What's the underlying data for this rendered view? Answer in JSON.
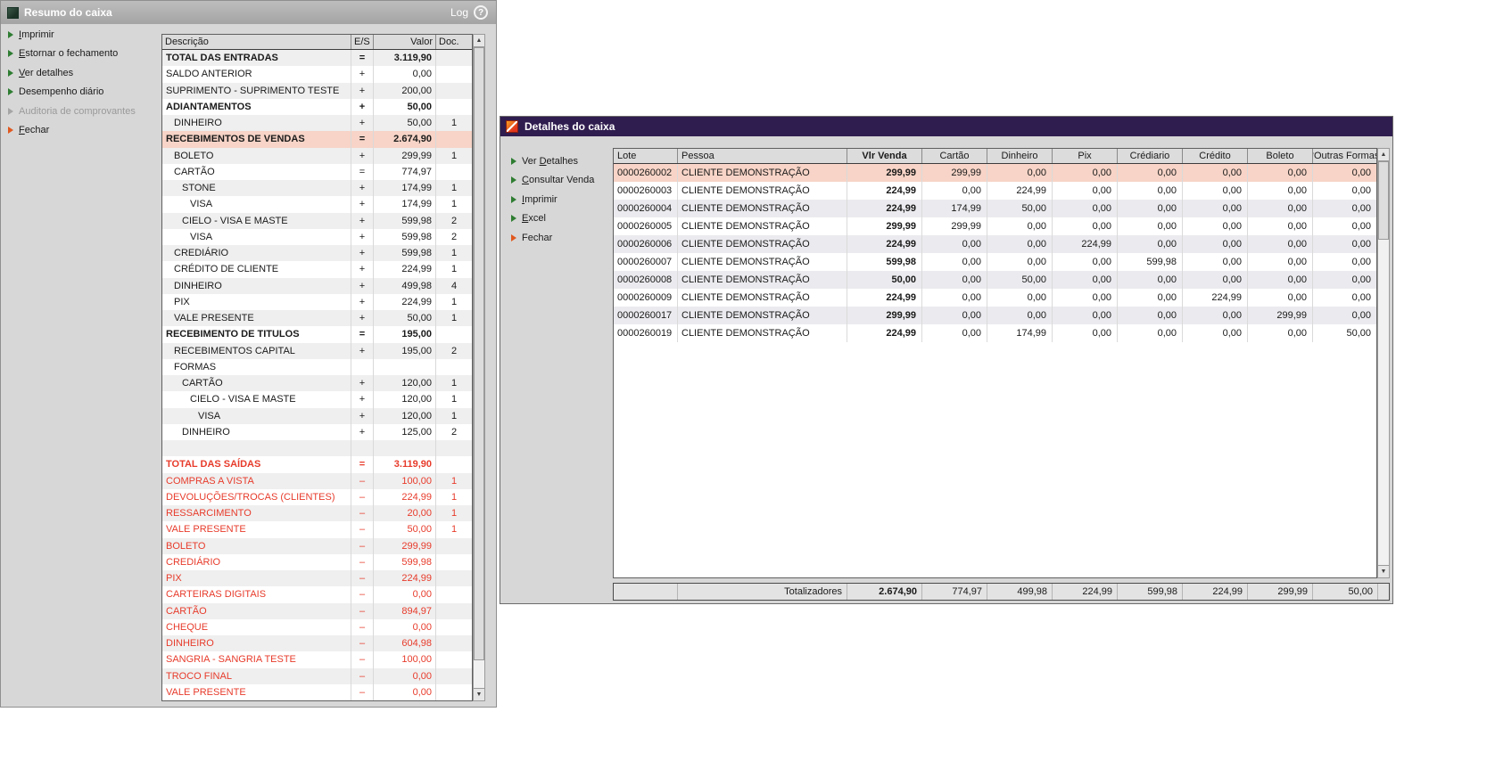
{
  "colors": {
    "titlebar-gray": "#a4a4a4",
    "titlebar-purple": "#301d4f",
    "window-bg": "#d7d7d7",
    "pink-highlight": "#f7d4c7",
    "red-text": "#e73b2b",
    "green-arrow": "#2e7d32",
    "orange-arrow": "#e0581f",
    "alt-row": "#efefef",
    "alt-row-right": "#ebebef",
    "header-bg": "#dcdcdc"
  },
  "icons": {
    "scroll_up": "▲",
    "scroll_down": "▼",
    "help": "?"
  },
  "left_window": {
    "title": "Resumo do caixa",
    "titlebar": {
      "log_label": "Log"
    },
    "menu": [
      {
        "label": "Imprimir",
        "accel": 0,
        "enabled": true,
        "arrow": "green"
      },
      {
        "label": "Estornar o fechamento",
        "accel": 0,
        "enabled": true,
        "arrow": "green"
      },
      {
        "label": "Ver detalhes",
        "accel": 0,
        "enabled": true,
        "arrow": "green"
      },
      {
        "label": "Desempenho diário",
        "accel": null,
        "enabled": true,
        "arrow": "green"
      },
      {
        "label": "Auditoria de comprovantes",
        "accel": null,
        "enabled": false,
        "arrow": "green"
      },
      {
        "label": "Fechar",
        "accel": 0,
        "enabled": true,
        "arrow": "orange"
      }
    ],
    "table": {
      "headers": [
        "Descrição",
        "E/S",
        "Valor",
        "Doc."
      ],
      "rows": [
        {
          "desc": "TOTAL DAS ENTRADAS",
          "indent": 0,
          "es": "=",
          "valor": "3.119,90",
          "doc": "",
          "bold": true,
          "style": "normal"
        },
        {
          "desc": "SALDO ANTERIOR",
          "indent": 0,
          "es": "+",
          "valor": "0,00",
          "doc": "",
          "bold": false,
          "style": "normal"
        },
        {
          "desc": "SUPRIMENTO - SUPRIMENTO TESTE",
          "indent": 0,
          "es": "+",
          "valor": "200,00",
          "doc": "",
          "bold": false,
          "style": "normal"
        },
        {
          "desc": "ADIANTAMENTOS",
          "indent": 0,
          "es": "+",
          "valor": "50,00",
          "doc": "",
          "bold": true,
          "style": "normal"
        },
        {
          "desc": "DINHEIRO",
          "indent": 1,
          "es": "+",
          "valor": "50,00",
          "doc": "1",
          "bold": false,
          "style": "normal"
        },
        {
          "desc": "RECEBIMENTOS DE VENDAS",
          "indent": 0,
          "es": "=",
          "valor": "2.674,90",
          "doc": "",
          "bold": true,
          "style": "pink"
        },
        {
          "desc": "BOLETO",
          "indent": 1,
          "es": "+",
          "valor": "299,99",
          "doc": "1",
          "bold": false,
          "style": "normal"
        },
        {
          "desc": "CARTÃO",
          "indent": 1,
          "es": "=",
          "valor": "774,97",
          "doc": "",
          "bold": false,
          "style": "normal"
        },
        {
          "desc": "STONE",
          "indent": 2,
          "es": "+",
          "valor": "174,99",
          "doc": "1",
          "bold": false,
          "style": "normal"
        },
        {
          "desc": "VISA",
          "indent": 3,
          "es": "+",
          "valor": "174,99",
          "doc": "1",
          "bold": false,
          "style": "normal"
        },
        {
          "desc": "CIELO - VISA E MASTE",
          "indent": 2,
          "es": "+",
          "valor": "599,98",
          "doc": "2",
          "bold": false,
          "style": "normal"
        },
        {
          "desc": "VISA",
          "indent": 3,
          "es": "+",
          "valor": "599,98",
          "doc": "2",
          "bold": false,
          "style": "normal"
        },
        {
          "desc": "CREDIÁRIO",
          "indent": 1,
          "es": "+",
          "valor": "599,98",
          "doc": "1",
          "bold": false,
          "style": "normal"
        },
        {
          "desc": "CRÉDITO DE CLIENTE",
          "indent": 1,
          "es": "+",
          "valor": "224,99",
          "doc": "1",
          "bold": false,
          "style": "normal"
        },
        {
          "desc": "DINHEIRO",
          "indent": 1,
          "es": "+",
          "valor": "499,98",
          "doc": "4",
          "bold": false,
          "style": "normal"
        },
        {
          "desc": "PIX",
          "indent": 1,
          "es": "+",
          "valor": "224,99",
          "doc": "1",
          "bold": false,
          "style": "normal"
        },
        {
          "desc": "VALE PRESENTE",
          "indent": 1,
          "es": "+",
          "valor": "50,00",
          "doc": "1",
          "bold": false,
          "style": "normal"
        },
        {
          "desc": "RECEBIMENTO DE TITULOS",
          "indent": 0,
          "es": "=",
          "valor": "195,00",
          "doc": "",
          "bold": true,
          "style": "normal"
        },
        {
          "desc": "RECEBIMENTOS CAPITAL",
          "indent": 1,
          "es": "+",
          "valor": "195,00",
          "doc": "2",
          "bold": false,
          "style": "normal"
        },
        {
          "desc": "FORMAS",
          "indent": 1,
          "es": "",
          "valor": "",
          "doc": "",
          "bold": false,
          "style": "normal"
        },
        {
          "desc": "CARTÃO",
          "indent": 2,
          "es": "+",
          "valor": "120,00",
          "doc": "1",
          "bold": false,
          "style": "normal"
        },
        {
          "desc": "CIELO - VISA E MASTE",
          "indent": 3,
          "es": "+",
          "valor": "120,00",
          "doc": "1",
          "bold": false,
          "style": "normal"
        },
        {
          "desc": "VISA",
          "indent": 4,
          "es": "+",
          "valor": "120,00",
          "doc": "1",
          "bold": false,
          "style": "normal"
        },
        {
          "desc": "DINHEIRO",
          "indent": 2,
          "es": "+",
          "valor": "125,00",
          "doc": "2",
          "bold": false,
          "style": "normal"
        },
        {
          "desc": "",
          "indent": 0,
          "es": "",
          "valor": "",
          "doc": "",
          "bold": false,
          "style": "normal"
        },
        {
          "desc": "TOTAL DAS SAÍDAS",
          "indent": 0,
          "es": "=",
          "valor": "3.119,90",
          "doc": "",
          "bold": true,
          "style": "red"
        },
        {
          "desc": "COMPRAS A VISTA",
          "indent": 0,
          "es": "–",
          "valor": "100,00",
          "doc": "1",
          "bold": false,
          "style": "red"
        },
        {
          "desc": "DEVOLUÇÕES/TROCAS (CLIENTES)",
          "indent": 0,
          "es": "–",
          "valor": "224,99",
          "doc": "1",
          "bold": false,
          "style": "red"
        },
        {
          "desc": "RESSARCIMENTO",
          "indent": 0,
          "es": "–",
          "valor": "20,00",
          "doc": "1",
          "bold": false,
          "style": "red"
        },
        {
          "desc": "VALE PRESENTE",
          "indent": 0,
          "es": "–",
          "valor": "50,00",
          "doc": "1",
          "bold": false,
          "style": "red"
        },
        {
          "desc": "BOLETO",
          "indent": 0,
          "es": "–",
          "valor": "299,99",
          "doc": "",
          "bold": false,
          "style": "red"
        },
        {
          "desc": "CREDIÁRIO",
          "indent": 0,
          "es": "–",
          "valor": "599,98",
          "doc": "",
          "bold": false,
          "style": "red"
        },
        {
          "desc": "PIX",
          "indent": 0,
          "es": "–",
          "valor": "224,99",
          "doc": "",
          "bold": false,
          "style": "red"
        },
        {
          "desc": "CARTEIRAS DIGITAIS",
          "indent": 0,
          "es": "–",
          "valor": "0,00",
          "doc": "",
          "bold": false,
          "style": "red"
        },
        {
          "desc": "CARTÃO",
          "indent": 0,
          "es": "–",
          "valor": "894,97",
          "doc": "",
          "bold": false,
          "style": "red"
        },
        {
          "desc": "CHEQUE",
          "indent": 0,
          "es": "–",
          "valor": "0,00",
          "doc": "",
          "bold": false,
          "style": "red"
        },
        {
          "desc": "DINHEIRO",
          "indent": 0,
          "es": "–",
          "valor": "604,98",
          "doc": "",
          "bold": false,
          "style": "red"
        },
        {
          "desc": "SANGRIA - SANGRIA TESTE",
          "indent": 0,
          "es": "–",
          "valor": "100,00",
          "doc": "",
          "bold": false,
          "style": "red"
        },
        {
          "desc": "TROCO FINAL",
          "indent": 0,
          "es": "–",
          "valor": "0,00",
          "doc": "",
          "bold": false,
          "style": "red"
        },
        {
          "desc": "VALE PRESENTE",
          "indent": 0,
          "es": "–",
          "valor": "0,00",
          "doc": "",
          "bold": false,
          "style": "red"
        }
      ]
    }
  },
  "right_window": {
    "title": "Detalhes do caixa",
    "menu": [
      {
        "label": "Ver Detalhes",
        "accel": 4,
        "enabled": true,
        "arrow": "green"
      },
      {
        "label": "Consultar Venda",
        "accel": 0,
        "enabled": true,
        "arrow": "green"
      },
      {
        "label": "Imprimir",
        "accel": 0,
        "enabled": true,
        "arrow": "green"
      },
      {
        "label": "Excel",
        "accel": 0,
        "enabled": true,
        "arrow": "green"
      },
      {
        "label": "Fechar",
        "accel": null,
        "enabled": true,
        "arrow": "orange"
      }
    ],
    "table": {
      "headers": [
        "Lote",
        "Pessoa",
        "Vlr Venda",
        "Cartão",
        "Dinheiro",
        "Pix",
        "Crédiario",
        "Crédito",
        "Boleto",
        "*Outras Formas"
      ],
      "rows": [
        {
          "lote": "0000260002",
          "pessoa": "CLIENTE DEMONSTRAÇÃO",
          "values": [
            "299,99",
            "299,99",
            "0,00",
            "0,00",
            "0,00",
            "0,00",
            "0,00",
            "0,00"
          ],
          "selected": true
        },
        {
          "lote": "0000260003",
          "pessoa": "CLIENTE DEMONSTRAÇÃO",
          "values": [
            "224,99",
            "0,00",
            "224,99",
            "0,00",
            "0,00",
            "0,00",
            "0,00",
            "0,00"
          ],
          "selected": false
        },
        {
          "lote": "0000260004",
          "pessoa": "CLIENTE DEMONSTRAÇÃO",
          "values": [
            "224,99",
            "174,99",
            "50,00",
            "0,00",
            "0,00",
            "0,00",
            "0,00",
            "0,00"
          ],
          "selected": false
        },
        {
          "lote": "0000260005",
          "pessoa": "CLIENTE DEMONSTRAÇÃO",
          "values": [
            "299,99",
            "299,99",
            "0,00",
            "0,00",
            "0,00",
            "0,00",
            "0,00",
            "0,00"
          ],
          "selected": false
        },
        {
          "lote": "0000260006",
          "pessoa": "CLIENTE DEMONSTRAÇÃO",
          "values": [
            "224,99",
            "0,00",
            "0,00",
            "224,99",
            "0,00",
            "0,00",
            "0,00",
            "0,00"
          ],
          "selected": false
        },
        {
          "lote": "0000260007",
          "pessoa": "CLIENTE DEMONSTRAÇÃO",
          "values": [
            "599,98",
            "0,00",
            "0,00",
            "0,00",
            "599,98",
            "0,00",
            "0,00",
            "0,00"
          ],
          "selected": false
        },
        {
          "lote": "0000260008",
          "pessoa": "CLIENTE DEMONSTRAÇÃO",
          "values": [
            "50,00",
            "0,00",
            "50,00",
            "0,00",
            "0,00",
            "0,00",
            "0,00",
            "0,00"
          ],
          "selected": false
        },
        {
          "lote": "0000260009",
          "pessoa": "CLIENTE DEMONSTRAÇÃO",
          "values": [
            "224,99",
            "0,00",
            "0,00",
            "0,00",
            "0,00",
            "224,99",
            "0,00",
            "0,00"
          ],
          "selected": false
        },
        {
          "lote": "0000260017",
          "pessoa": "CLIENTE DEMONSTRAÇÃO",
          "values": [
            "299,99",
            "0,00",
            "0,00",
            "0,00",
            "0,00",
            "0,00",
            "299,99",
            "0,00"
          ],
          "selected": false
        },
        {
          "lote": "0000260019",
          "pessoa": "CLIENTE DEMONSTRAÇÃO",
          "values": [
            "224,99",
            "0,00",
            "174,99",
            "0,00",
            "0,00",
            "0,00",
            "0,00",
            "50,00"
          ],
          "selected": false
        }
      ],
      "totals_label": "Totalizadores",
      "totals": [
        "2.674,90",
        "774,97",
        "499,98",
        "224,99",
        "599,98",
        "224,99",
        "299,99",
        "50,00"
      ]
    }
  }
}
